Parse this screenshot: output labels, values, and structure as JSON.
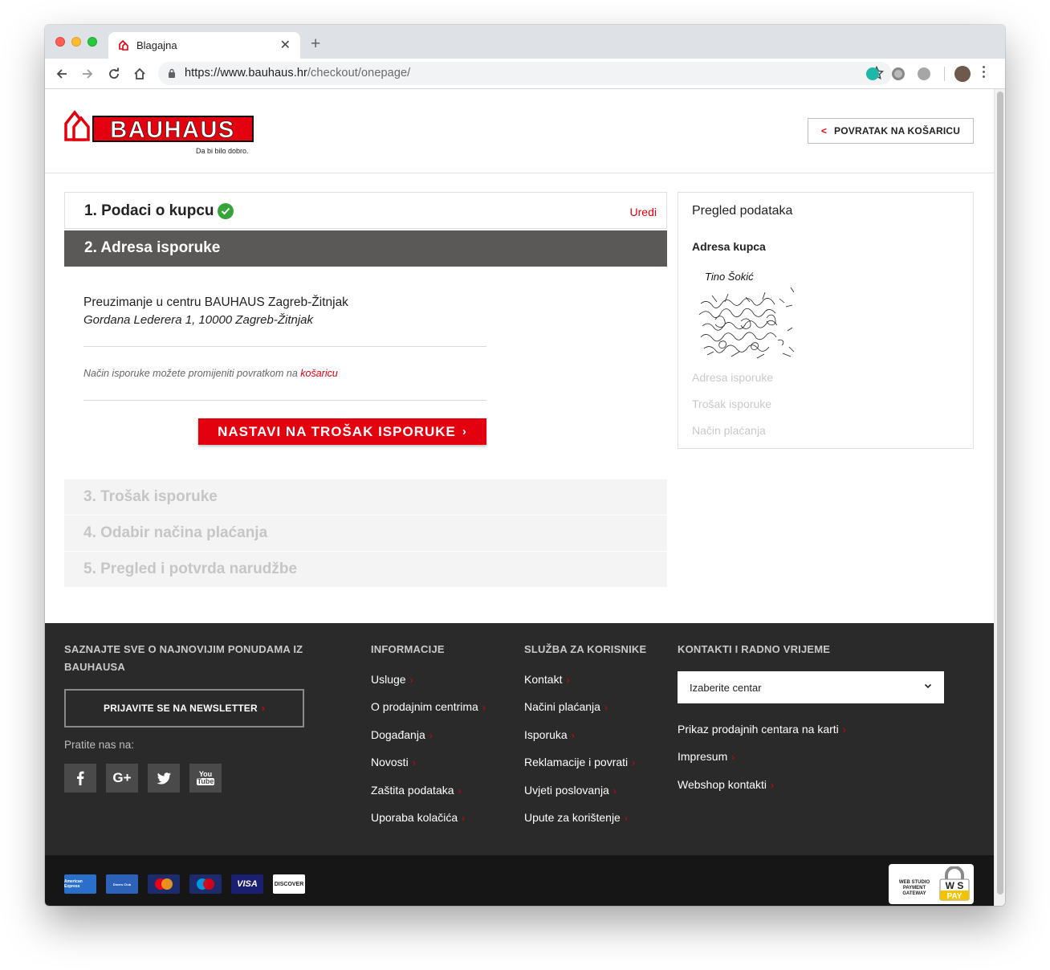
{
  "browser": {
    "tab_title": "Blagajna",
    "url_host": "https://www.bauhaus.hr",
    "url_path": "/checkout/onepage/"
  },
  "header": {
    "brand": "BAUHAUS",
    "tagline": "Da bi bilo dobro.",
    "back_to_cart": "POVRATAK NA KOŠARICU"
  },
  "checkout": {
    "step1_title": "1. Podaci o kupcu",
    "step1_edit": "Uredi",
    "step2_title": "2. Adresa isporuke",
    "pickup_store": "Preuzimanje u centru BAUHAUS Zagreb-Žitnjak",
    "pickup_address": "Gordana Lederera 1, 10000 Zagreb-Žitnjak",
    "note_text": "Način isporuke možete promijeniti povratkom na ",
    "note_link": "košaricu",
    "continue_button": "NASTAVI NA TROŠAK ISPORUKE",
    "step3_title": "3. Trošak isporuke",
    "step4_title": "4. Odabir načina plaćanja",
    "step5_title": "5. Pregled i potvrda narudžbe"
  },
  "summary": {
    "title": "Pregled podataka",
    "buyer_address_label": "Adresa kupca",
    "buyer_name": "Tino Šokić",
    "shipping_address": "Adresa isporuke",
    "shipping_cost": "Trošak isporuke",
    "payment_method": "Način plaćanja"
  },
  "footer": {
    "newsletter_heading": "SAZNAJTE SVE O NAJNOVIJIM PONUDAMA IZ BAUHAUSA",
    "newsletter_button": "PRIJAVITE SE NA NEWSLETTER",
    "follow_us": "Pratite nas na:",
    "social": [
      "facebook-icon",
      "google-plus-icon",
      "twitter-icon",
      "youtube-icon"
    ],
    "info_heading": "INFORMACIJE",
    "info_links": [
      "Usluge",
      "O prodajnim centrima",
      "Događanja",
      "Novosti",
      "Zaštita podataka",
      "Uporaba kolačića"
    ],
    "service_heading": "SLUŽBA ZA KORISNIKE",
    "service_links": [
      "Kontakt",
      "Načini plaćanja",
      "Isporuka",
      "Reklamacije i povrati",
      "Uvjeti poslovanja",
      "Upute za korištenje"
    ],
    "contact_heading": "KONTAKTI I RADNO VRIJEME",
    "center_select": "Izaberite centar",
    "contact_links": [
      "Prikaz prodajnih centara na karti",
      "Impresum",
      "Webshop kontakti"
    ],
    "payment_cards": [
      "American Express",
      "Diners Club",
      "MasterCard",
      "Maestro",
      "VISA",
      "DISCOVER"
    ],
    "wspay_text": "WEB STUDIO PAYMENT GATEWAY",
    "wspay_logo": "WS PAY"
  },
  "colors": {
    "brand_red": "#e3000f",
    "step_active_bg": "#5a5958",
    "footer_bg": "#2a2a2a",
    "success_green": "#36a43a"
  }
}
